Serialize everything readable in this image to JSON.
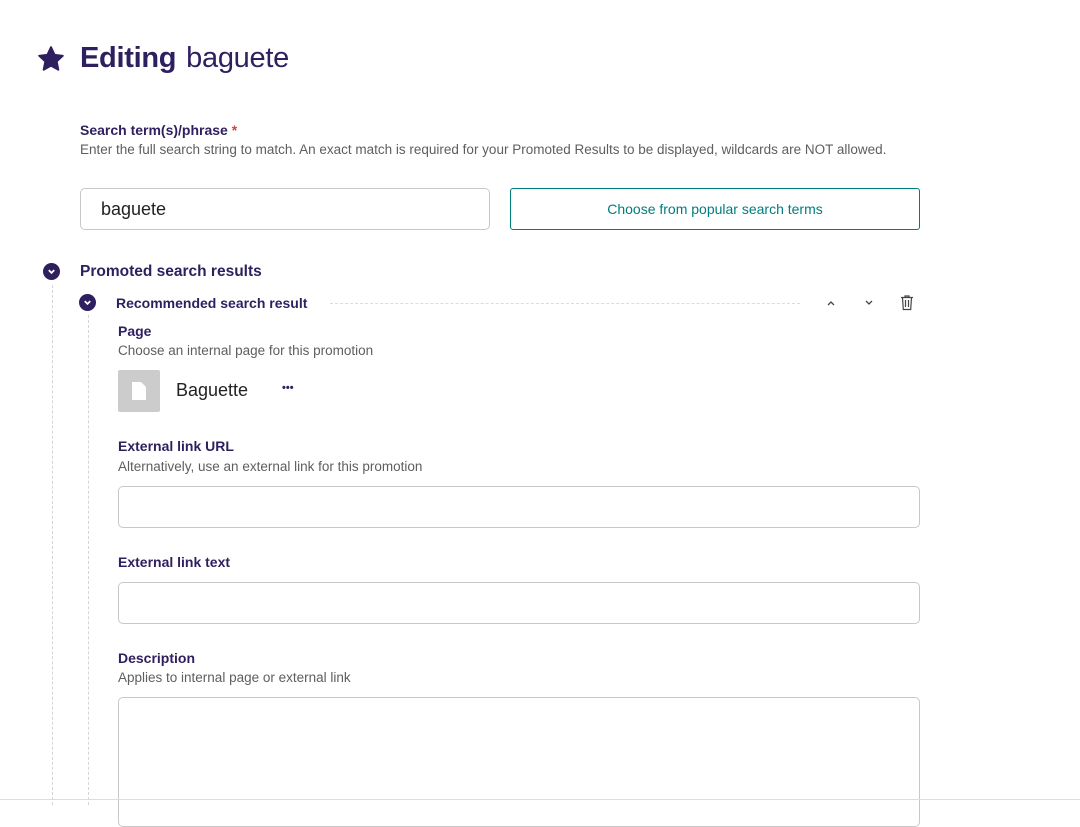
{
  "header": {
    "title": "Editing",
    "subtitle": "baguete"
  },
  "search_term": {
    "label": "Search term(s)/phrase",
    "required_mark": "*",
    "help": "Enter the full search string to match. An exact match is required for your Promoted Results to be displayed, wildcards are NOT allowed.",
    "value": "baguete",
    "choose_button": "Choose from popular search terms"
  },
  "promoted": {
    "heading": "Promoted search results",
    "item": {
      "heading": "Recommended search result",
      "page": {
        "label": "Page",
        "help": "Choose an internal page for this promotion",
        "selected_title": "Baguette",
        "menu": "•••"
      },
      "external_url": {
        "label": "External link URL",
        "help": "Alternatively, use an external link for this promotion",
        "value": ""
      },
      "external_text": {
        "label": "External link text",
        "value": ""
      },
      "description": {
        "label": "Description",
        "help": "Applies to internal page or external link",
        "value": ""
      }
    }
  },
  "colors": {
    "primary": "#2e1f5e",
    "accent": "#007d7e",
    "required": "#cd4444"
  }
}
